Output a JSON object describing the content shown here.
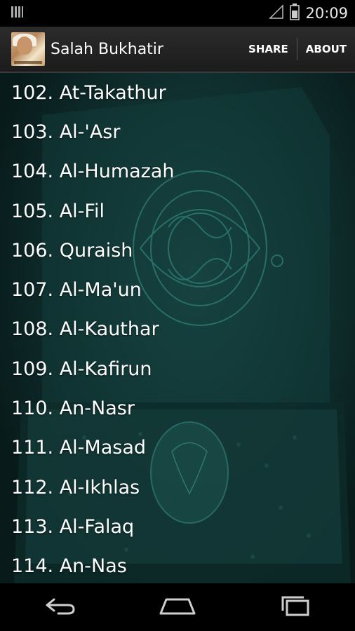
{
  "status_bar": {
    "time": "20:09",
    "icons": [
      "notification-icon",
      "signal-icon",
      "battery-icon"
    ]
  },
  "action_bar": {
    "title": "Salah Bukhatir",
    "share_label": "SHARE",
    "about_label": "ABOUT"
  },
  "surahs": [
    "102. At-Takathur",
    "103. Al-'Asr",
    "104. Al-Humazah",
    "105. Al-Fil",
    "106. Quraish",
    "107. Al-Ma'un",
    "108. Al-Kauthar",
    "109. Al-Kafirun",
    "110. An-Nasr",
    "111. Al-Masad",
    "112. Al-Ikhlas",
    "113. Al-Falaq",
    "114. An-Nas"
  ],
  "nav_bar": {
    "buttons": [
      "back-icon",
      "home-icon",
      "recent-apps-icon"
    ]
  },
  "colors": {
    "background": "#0f2f2e",
    "accent": "#2a6b66",
    "text": "#ffffff"
  }
}
